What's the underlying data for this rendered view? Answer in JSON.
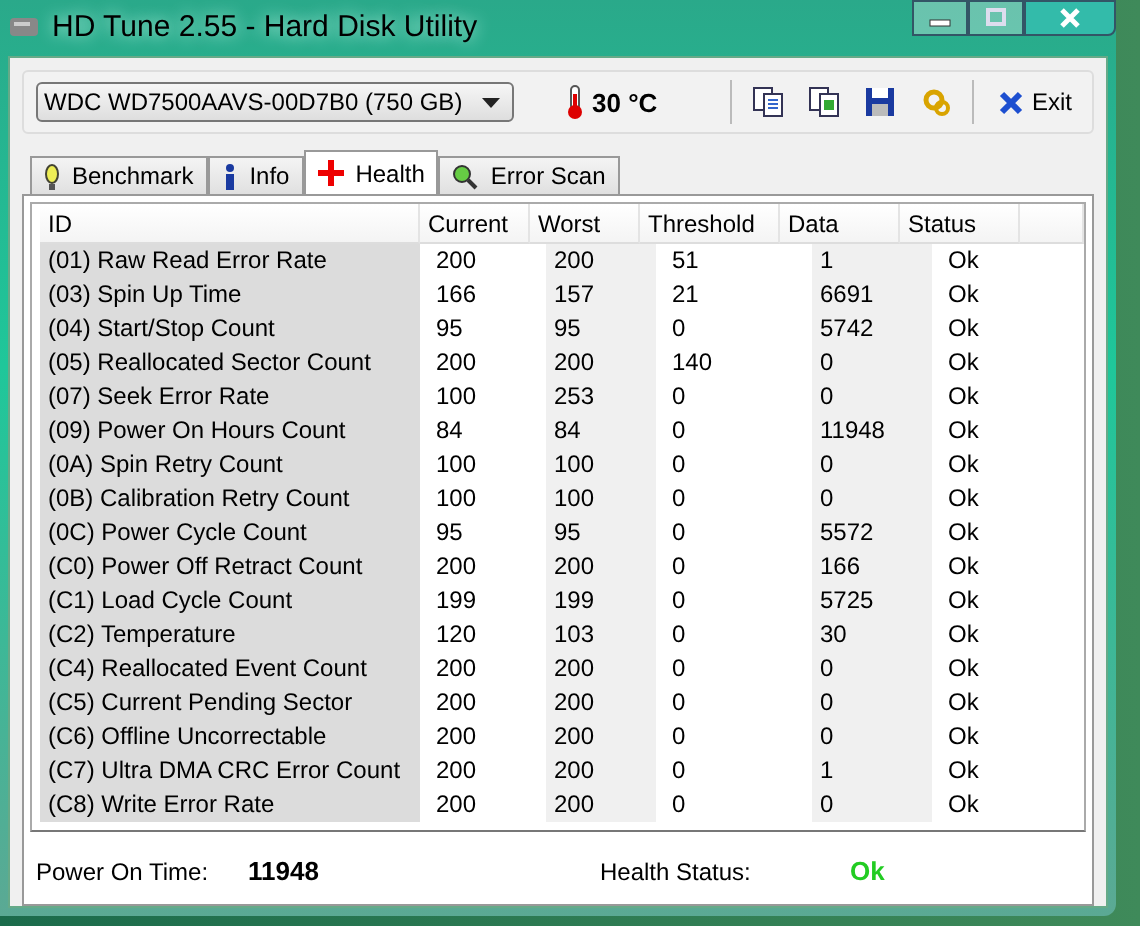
{
  "window": {
    "title": "HD Tune 2.55 - Hard Disk Utility"
  },
  "toolbar": {
    "drive": "WDC WD7500AAVS-00D7B0 (750 GB)",
    "temperature": "30 °C",
    "exit": "Exit"
  },
  "tabs": [
    {
      "label": "Benchmark",
      "selected": false
    },
    {
      "label": "Info",
      "selected": false
    },
    {
      "label": "Health",
      "selected": true
    },
    {
      "label": "Error Scan",
      "selected": false
    }
  ],
  "table": {
    "columns": [
      "ID",
      "Current",
      "Worst",
      "Threshold",
      "Data",
      "Status"
    ],
    "rows": [
      [
        "(01) Raw Read Error Rate",
        "200",
        "200",
        "51",
        "1",
        "Ok"
      ],
      [
        "(03) Spin Up Time",
        "166",
        "157",
        "21",
        "6691",
        "Ok"
      ],
      [
        "(04) Start/Stop Count",
        "95",
        "95",
        "0",
        "5742",
        "Ok"
      ],
      [
        "(05) Reallocated Sector Count",
        "200",
        "200",
        "140",
        "0",
        "Ok"
      ],
      [
        "(07) Seek Error Rate",
        "100",
        "253",
        "0",
        "0",
        "Ok"
      ],
      [
        "(09) Power On Hours Count",
        "84",
        "84",
        "0",
        "11948",
        "Ok"
      ],
      [
        "(0A) Spin Retry Count",
        "100",
        "100",
        "0",
        "0",
        "Ok"
      ],
      [
        "(0B) Calibration Retry Count",
        "100",
        "100",
        "0",
        "0",
        "Ok"
      ],
      [
        "(0C) Power Cycle Count",
        "95",
        "95",
        "0",
        "5572",
        "Ok"
      ],
      [
        "(C0) Power Off Retract Count",
        "200",
        "200",
        "0",
        "166",
        "Ok"
      ],
      [
        "(C1) Load Cycle Count",
        "199",
        "199",
        "0",
        "5725",
        "Ok"
      ],
      [
        "(C2) Temperature",
        "120",
        "103",
        "0",
        "30",
        "Ok"
      ],
      [
        "(C4) Reallocated Event Count",
        "200",
        "200",
        "0",
        "0",
        "Ok"
      ],
      [
        "(C5) Current Pending Sector",
        "200",
        "200",
        "0",
        "0",
        "Ok"
      ],
      [
        "(C6) Offline Uncorrectable",
        "200",
        "200",
        "0",
        "0",
        "Ok"
      ],
      [
        "(C7) Ultra DMA CRC Error Count",
        "200",
        "200",
        "0",
        "1",
        "Ok"
      ],
      [
        "(C8) Write Error Rate",
        "200",
        "200",
        "0",
        "0",
        "Ok"
      ]
    ]
  },
  "footer": {
    "power_on_label": "Power On Time:",
    "power_on_value": "11948",
    "health_label": "Health Status:",
    "health_value": "Ok"
  }
}
